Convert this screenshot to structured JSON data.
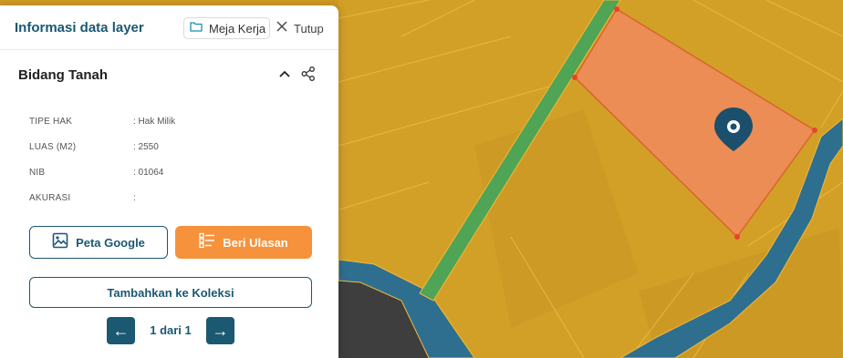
{
  "panel": {
    "title": "Informasi data layer",
    "workspace_label": "Meja Kerja",
    "close_label": "Tutup"
  },
  "section": {
    "title": "Bidang Tanah"
  },
  "attributes": [
    {
      "key": "TIPE HAK",
      "value": ": Hak Milik"
    },
    {
      "key": "LUAS (M2)",
      "value": ": 2550"
    },
    {
      "key": "NIB",
      "value": ": 01064"
    },
    {
      "key": "AKURASI",
      "value": ":"
    }
  ],
  "actions": {
    "google_label": "Peta Google",
    "review_label": "Beri Ulasan",
    "collection_label": "Tambahkan ke Koleksi"
  },
  "pagination": {
    "prev": "←",
    "text": "1 dari 1",
    "next": "→"
  },
  "icons": {
    "folder": "folder-icon",
    "close": "close-icon",
    "chevron": "chevron-up-icon",
    "share": "share-icon",
    "image": "image-icon",
    "review": "list-check-icon",
    "pin": "location-pin-icon"
  },
  "colors": {
    "accent": "#1b5872",
    "review_button": "#f6923c",
    "parcel_fill": "#d9a026",
    "selected_parcel": "#ee8c58",
    "road": "#4fa455",
    "river": "#2e6f8f"
  }
}
